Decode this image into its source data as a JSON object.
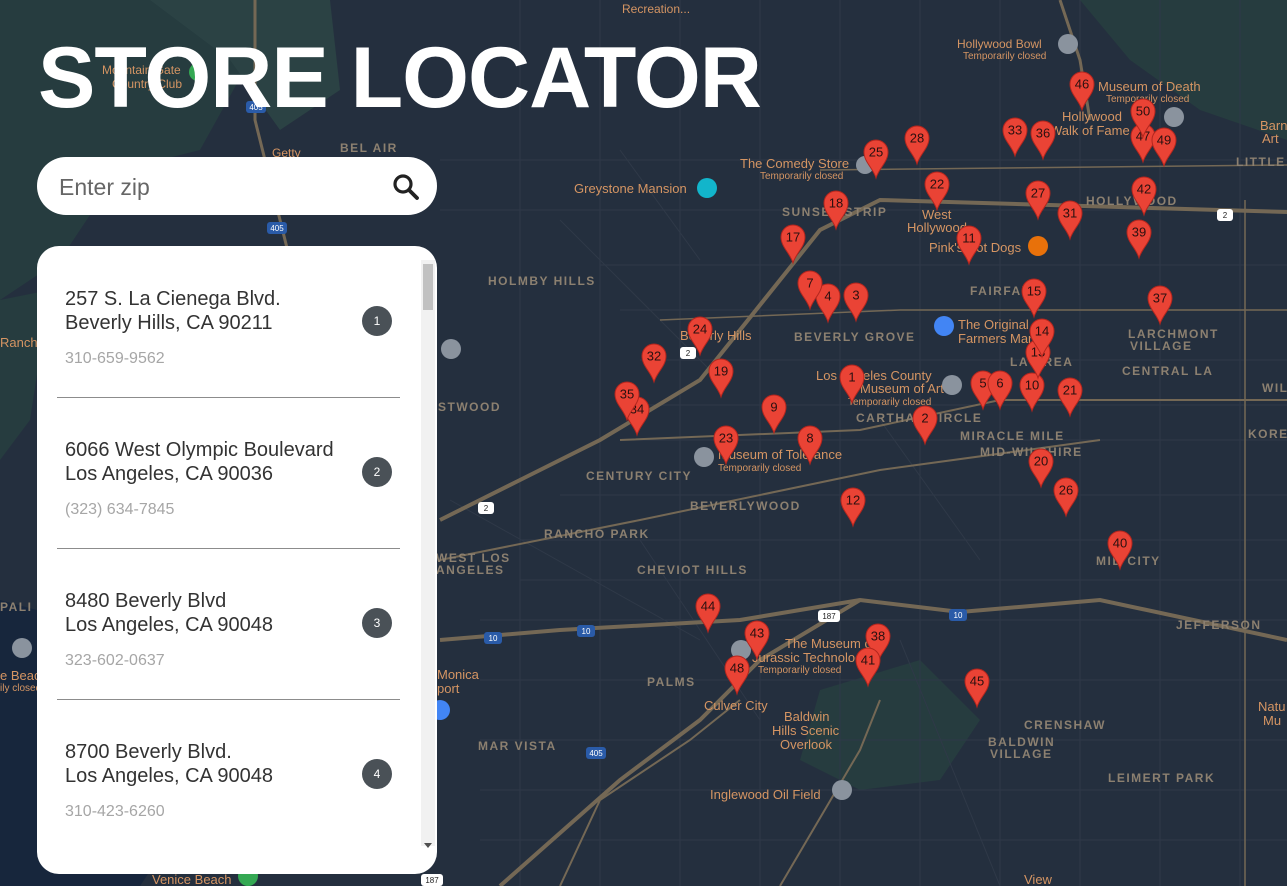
{
  "header": {
    "title": "STORE LOCATOR"
  },
  "search": {
    "placeholder": "Enter zip",
    "icon": "search-icon"
  },
  "stores": [
    {
      "address_line1": "257 S. La Cienega Blvd.",
      "address_line2": "Beverly Hills, CA 90211",
      "phone": "310-659-9562",
      "number": "1"
    },
    {
      "address_line1": "6066 West Olympic Boulevard",
      "address_line2": "Los Angeles, CA 90036",
      "phone": "(323) 634-7845",
      "number": "2"
    },
    {
      "address_line1": "8480 Beverly Blvd",
      "address_line2": "Los Angeles, CA 90048",
      "phone": "323-602-0637",
      "number": "3"
    },
    {
      "address_line1": "8700 Beverly Blvd.",
      "address_line2": "Los Angeles, CA 90048",
      "phone": "310-423-6260",
      "number": "4"
    }
  ],
  "map": {
    "places": {
      "recreation": "Recreation...",
      "mountain_gate": "Mountain Gate",
      "country_club": "Country Club",
      "getty": "Getty",
      "bel_air": "BEL AIR",
      "hollywood_bowl": "Hollywood Bowl",
      "hollywood_bowl_status": "Temporarily closed",
      "museum_of_death": "Museum of Death",
      "museum_of_death_status": "Temporarily closed",
      "hollywood_walk": "Hollywood",
      "walk_of_fame": "Walk of Fame",
      "comedy_store": "The Comedy Store",
      "comedy_store_status": "Temporarily closed",
      "greystone": "Greystone Mansion",
      "sunset_strip": "SUNSET STRIP",
      "west_hollywood_1": "West",
      "west_hollywood_2": "Hollywood",
      "pinks": "Pink's Hot Dogs",
      "hollywood": "HOLLYWOOD",
      "holmby_hills": "HOLMBY HILLS",
      "fairfax": "FAIRFAX",
      "beverly_grove": "BEVERLY GROVE",
      "beverly_hills": "Beverly Hills",
      "original_farmers_1": "The Original",
      "original_farmers_2": "Farmers Market",
      "larchmont_1": "LARCHMONT",
      "larchmont_2": "VILLAGE",
      "la_brea": "LA BREA",
      "central_la": "CENTRAL LA",
      "lacma_1": "Los Angeles County",
      "lacma_2": "Museum of Art",
      "lacma_status": "Temporarily closed",
      "carthay_circle": "CARTHAY CIRCLE",
      "miracle_mile": "MIRACLE MILE",
      "mid_wilshire": "MID-WILSHIRE",
      "westwood": "STWOOD",
      "museum_tolerance": "Museum of Tolerance",
      "museum_tolerance_status": "Temporarily closed",
      "century_city": "CENTURY CITY",
      "beverlywood": "BEVERLYWOOD",
      "rancho_park": "RANCHO PARK",
      "west_los_angeles_1": "WEST LOS",
      "west_los_angeles_2": "ANGELES",
      "cheviot_hills": "CHEVIOT HILLS",
      "mid_city": "MID CITY",
      "jefferson": "JEFFERSON",
      "museum_jurassic_1": "The Museum of",
      "museum_jurassic_2": "Jurassic Technology",
      "museum_jurassic_status": "Temporarily closed",
      "palms": "PALMS",
      "culver_city": "Culver City",
      "mar_vista": "MAR VISTA",
      "baldwin_overlook_1": "Baldwin",
      "baldwin_overlook_2": "Hills Scenic",
      "baldwin_overlook_3": "Overlook",
      "crenshaw": "CRENSHAW",
      "baldwin_village_1": "BALDWIN",
      "baldwin_village_2": "VILLAGE",
      "leimert_park": "LEIMERT PARK",
      "inglewood_oil": "Inglewood Oil Field",
      "santa_monica_1": "Monica",
      "santa_monica_2": "port",
      "venice_beach": "Venice Beach",
      "view": "View",
      "ranch": "Ranch",
      "beach": "e Beach",
      "beach_closed": "ily closed",
      "pali": "PALI",
      "natural": "Natu",
      "natural2": "Mu",
      "korea": "KORE",
      "wil": "WIL",
      "barn_1": "Barn",
      "barn_2": "Art",
      "little": "LITTLE"
    },
    "route_shields": [
      "405",
      "405",
      "10",
      "10",
      "10",
      "187",
      "187",
      "2",
      "2",
      "2",
      "405"
    ],
    "markers": [
      "1",
      "2",
      "3",
      "4",
      "5",
      "6",
      "7",
      "8",
      "9",
      "10",
      "11",
      "12",
      "13",
      "14",
      "15",
      "17",
      "18",
      "19",
      "20",
      "21",
      "22",
      "23",
      "24",
      "25",
      "26",
      "27",
      "28",
      "31",
      "32",
      "33",
      "34",
      "35",
      "36",
      "37",
      "38",
      "39",
      "40",
      "41",
      "42",
      "43",
      "44",
      "45",
      "46",
      "47",
      "48",
      "49",
      "50"
    ],
    "marker_color": "#ea4335",
    "background_color": "#242f3e",
    "road_color": "#746855"
  }
}
